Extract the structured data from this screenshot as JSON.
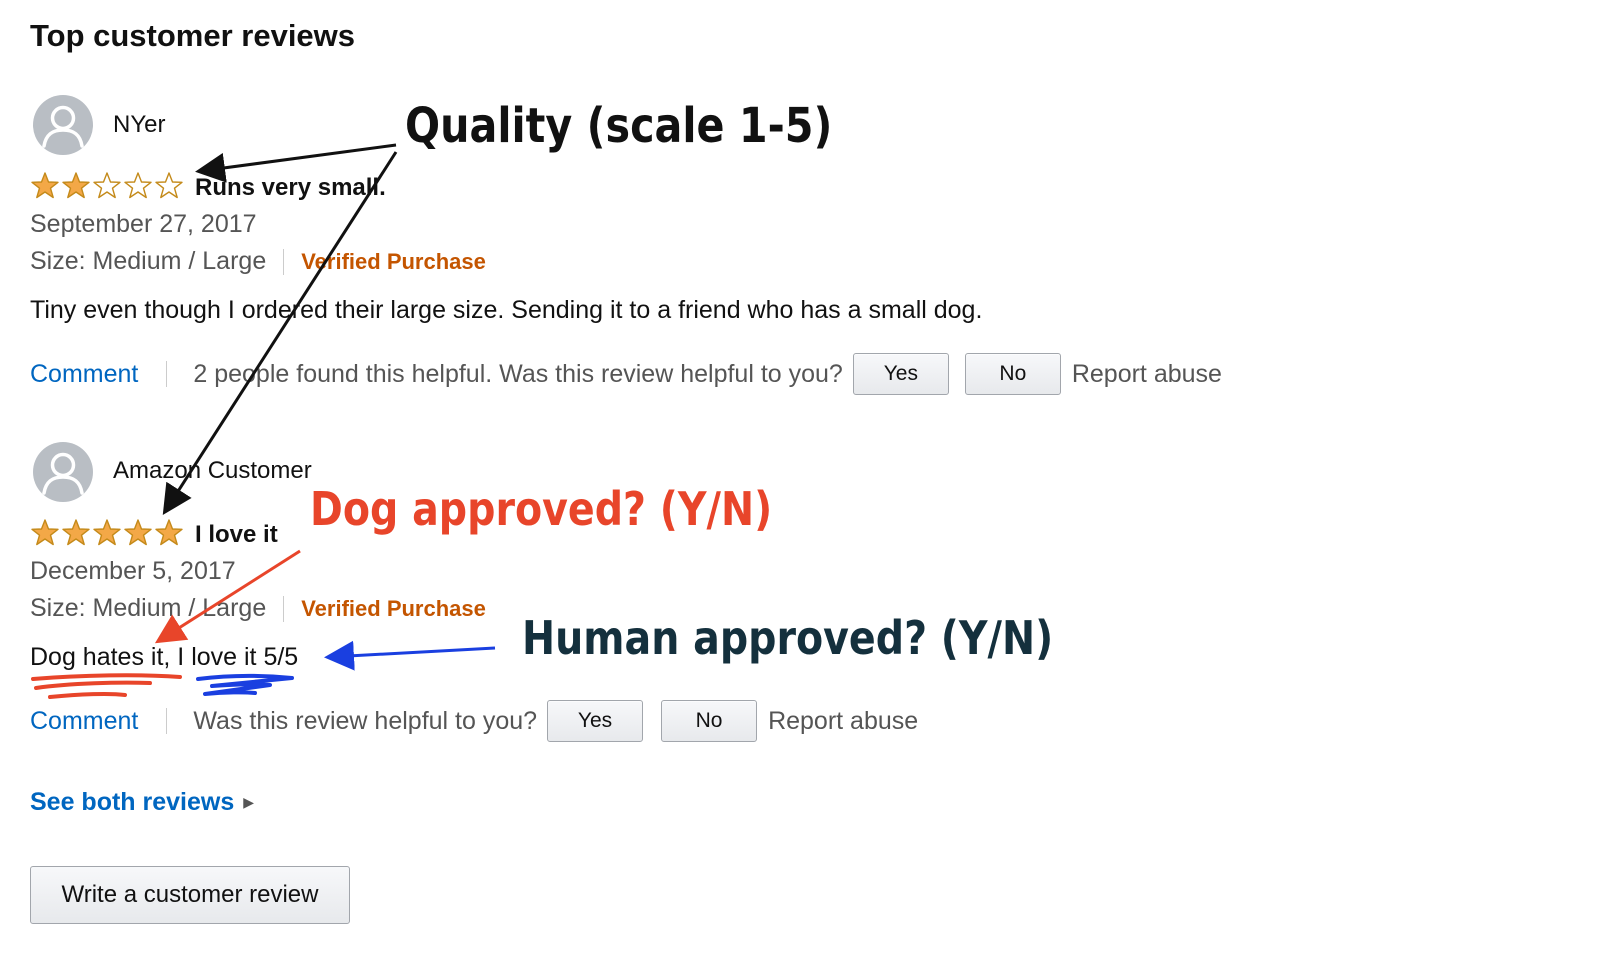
{
  "section_title": "Top customer reviews",
  "reviews": [
    {
      "reviewer": "NYer",
      "rating": 2,
      "max_rating": 5,
      "title": "Runs very small.",
      "date": "September 27, 2017",
      "size": "Size: Medium / Large",
      "verified": "Verified Purchase",
      "body": "Tiny even though I ordered their large size. Sending it to a friend who has a small dog.",
      "comment_label": "Comment",
      "helpful_text": "2 people found this helpful. Was this review helpful to you?",
      "yes_label": "Yes",
      "no_label": "No",
      "report_label": "Report abuse"
    },
    {
      "reviewer": "Amazon Customer",
      "rating": 5,
      "max_rating": 5,
      "title": "I love it",
      "date": "December 5, 2017",
      "size": "Size: Medium / Large",
      "verified": "Verified Purchase",
      "body": "Dog hates it, I love it 5/5",
      "comment_label": "Comment",
      "helpful_text": "Was this review helpful to you?",
      "yes_label": "Yes",
      "no_label": "No",
      "report_label": "Report abuse"
    }
  ],
  "see_all_label": "See both reviews",
  "write_review_label": "Write a customer review",
  "annotations": {
    "quality": "Quality (scale 1-5)",
    "dog": "Dog approved? (Y/N)",
    "human": "Human approved? (Y/N)"
  },
  "colors": {
    "link": "#0066c0",
    "verified": "#c45500",
    "star_fill": "#f3a847",
    "star_stroke": "#c48a1a",
    "annotation_dog": "#e8452a",
    "annotation_human": "#14303d",
    "underline_human": "#1a3fe0"
  },
  "icons": {
    "avatar": "user-avatar-icon",
    "star_full": "star-filled-icon",
    "star_empty": "star-empty-icon",
    "caret": "caret-right-icon"
  }
}
